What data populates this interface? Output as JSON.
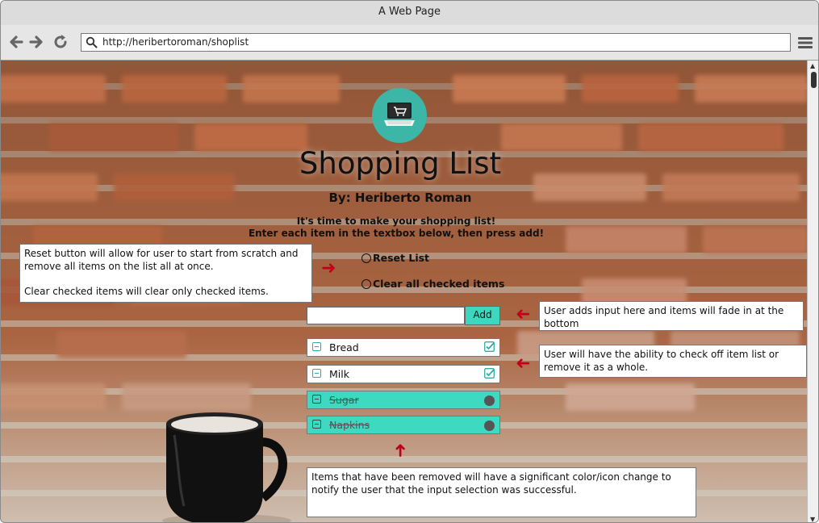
{
  "window": {
    "title": "A Web Page"
  },
  "browser": {
    "url": "http://heribertoroman/shoplist"
  },
  "page": {
    "title": "Shopping List",
    "byline": "By: Heriberto Roman",
    "intro_line1": "It's time to make your shopping list!",
    "intro_line2": "Enter each item in the textbox below, then press add!",
    "reset_label": "Reset List",
    "clear_label": "Clear all checked items",
    "add_label": "Add",
    "input_value": ""
  },
  "items": [
    {
      "label": "Bread",
      "state": "active",
      "checked": true
    },
    {
      "label": "Milk",
      "state": "active",
      "checked": true
    },
    {
      "label": "Sugar",
      "state": "removed",
      "checked": false
    },
    {
      "label": "Napkins",
      "state": "removed",
      "checked": false
    }
  ],
  "notes": {
    "reset": "Reset button will allow for user to start from scratch and remove all items on the list all at once.",
    "clear": "Clear checked items will clear only checked items.",
    "input": "User adds input here and items will fade in at the bottom",
    "check": "User will have the ability to check off item list or remove it as a whole.",
    "removed": "Items that have been removed will have a significant color/icon change to notify the user that the input selection was successful."
  },
  "colors": {
    "accent": "#3dd7c0",
    "arrow": "#c0001a",
    "logo": "#3cb6a6"
  },
  "icons": {
    "logo": "shopping-cart-laptop-icon",
    "back": "arrow-left-icon",
    "forward": "arrow-right-icon",
    "reload": "reload-icon",
    "search": "search-icon",
    "menu": "hamburger-menu-icon"
  }
}
